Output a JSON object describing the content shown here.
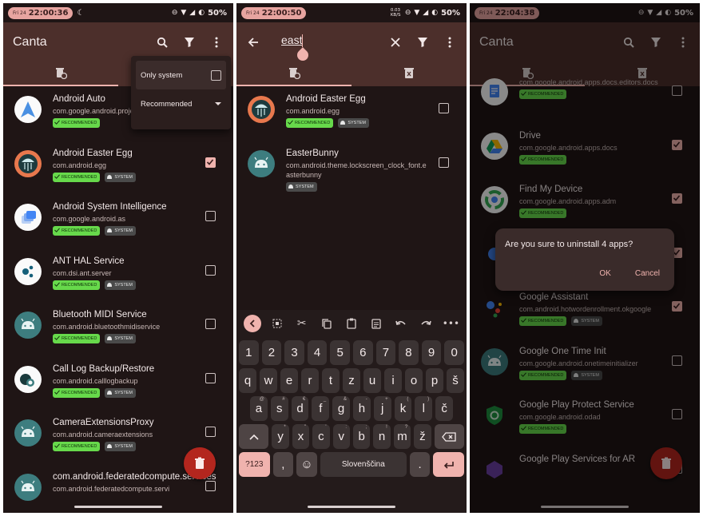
{
  "colors": {
    "background": "#1f1515",
    "appbar": "#4c2f2b",
    "accent": "#f0b3ae",
    "recommended_badge": "#67d94b",
    "system_badge": "#4a4a4a",
    "fab": "#b3261e"
  },
  "badges": {
    "recommended": "RECOMMENDED",
    "system": "SYSTEM"
  },
  "screen1": {
    "status": {
      "day": "Fri 24",
      "time": "22:00:36",
      "battery": "50%"
    },
    "app_title": "Canta",
    "menu": {
      "only_system_label": "Only system",
      "filter_value": "Recommended"
    },
    "apps": [
      {
        "name": "Android Auto",
        "package": "com.google.android.projection.gearhead",
        "recommended": true,
        "system": false,
        "checked": false,
        "icon": "android-auto-icon"
      },
      {
        "name": "Android Easter Egg",
        "package": "com.android.egg",
        "recommended": true,
        "system": true,
        "checked": true,
        "icon": "easter-egg-icon"
      },
      {
        "name": "Android System Intelligence",
        "package": "com.google.android.as",
        "recommended": true,
        "system": true,
        "checked": false,
        "icon": "system-intelligence-icon"
      },
      {
        "name": "ANT HAL Service",
        "package": "com.dsi.ant.server",
        "recommended": true,
        "system": true,
        "checked": false,
        "icon": "ant-icon"
      },
      {
        "name": "Bluetooth MIDI Service",
        "package": "com.android.bluetoothmidiservice",
        "recommended": true,
        "system": true,
        "checked": false,
        "icon": "android-icon"
      },
      {
        "name": "Call Log Backup/Restore",
        "package": "com.android.calllogbackup",
        "recommended": true,
        "system": true,
        "checked": false,
        "icon": "call-log-icon"
      },
      {
        "name": "CameraExtensionsProxy",
        "package": "com.android.cameraextensions",
        "recommended": true,
        "system": true,
        "checked": false,
        "icon": "android-icon"
      },
      {
        "name": "com.android.federatedcompute.services",
        "package": "com.android.federatedcompute.servi",
        "recommended": false,
        "system": false,
        "checked": false,
        "icon": "android-icon"
      }
    ]
  },
  "screen2": {
    "status": {
      "day": "Fri 24",
      "time": "22:00:50",
      "battery": "50%",
      "net": "0.03 KB/S"
    },
    "search_query": "east",
    "apps": [
      {
        "name": "Android Easter Egg",
        "package": "com.android.egg",
        "recommended": true,
        "system": true,
        "checked": false,
        "icon": "easter-egg-icon"
      },
      {
        "name": "EasterBunny",
        "package": "com.android.theme.lockscreen_clock_font.easterbunny",
        "recommended": false,
        "system": true,
        "checked": false,
        "icon": "android-icon"
      }
    ],
    "keyboard": {
      "numbers": [
        "1",
        "2",
        "3",
        "4",
        "5",
        "6",
        "7",
        "8",
        "9",
        "0"
      ],
      "row1": [
        "q",
        "w",
        "e",
        "r",
        "t",
        "z",
        "u",
        "i",
        "o",
        "p",
        "š"
      ],
      "row2": [
        "a",
        "s",
        "d",
        "f",
        "g",
        "h",
        "j",
        "k",
        "l",
        "č"
      ],
      "row2_hints": [
        "@",
        "#",
        "€",
        "_",
        "&",
        "-",
        "+",
        "(",
        ")",
        ""
      ],
      "row3": [
        "y",
        "x",
        "c",
        "v",
        "b",
        "n",
        "m",
        "ž"
      ],
      "row3_hints": [
        "*",
        "\"",
        "'",
        ":",
        ";",
        "!",
        "?",
        ""
      ],
      "sym_label": "?123",
      "comma": ",",
      "space_label": "Slovenščina",
      "period": "."
    }
  },
  "screen3": {
    "status": {
      "day": "Fri 24",
      "time": "22:04:38",
      "battery": "50%"
    },
    "app_title": "Canta",
    "dialog": {
      "message": "Are you sure to uninstall 4 apps?",
      "ok": "OK",
      "cancel": "Cancel"
    },
    "apps": [
      {
        "name": "",
        "package": "com.google.android.apps.docs.editors.docs",
        "recommended": true,
        "system": false,
        "checked": false,
        "icon": "docs-icon"
      },
      {
        "name": "Drive",
        "package": "com.google.android.apps.docs",
        "recommended": true,
        "system": false,
        "checked": true,
        "icon": "drive-icon"
      },
      {
        "name": "Find My Device",
        "package": "com.google.android.apps.adm",
        "recommended": true,
        "system": false,
        "checked": true,
        "icon": "find-my-device-icon"
      },
      {
        "name": "",
        "package": "",
        "recommended": false,
        "system": true,
        "checked": true,
        "icon": "dot-icon"
      },
      {
        "name": "Google Assistant",
        "package": "com.android.hotwordenrollment.okgoogle",
        "recommended": true,
        "system": true,
        "checked": true,
        "icon": "assistant-icon"
      },
      {
        "name": "Google One Time Init",
        "package": "com.google.android.onetimeinitializer",
        "recommended": true,
        "system": true,
        "checked": false,
        "icon": "android-icon"
      },
      {
        "name": "Google Play Protect Service",
        "package": "com.google.android.odad",
        "recommended": true,
        "system": false,
        "checked": false,
        "icon": "play-protect-icon"
      },
      {
        "name": "Google Play Services for AR",
        "package": "",
        "recommended": false,
        "system": false,
        "checked": false,
        "icon": "ar-icon"
      }
    ]
  }
}
